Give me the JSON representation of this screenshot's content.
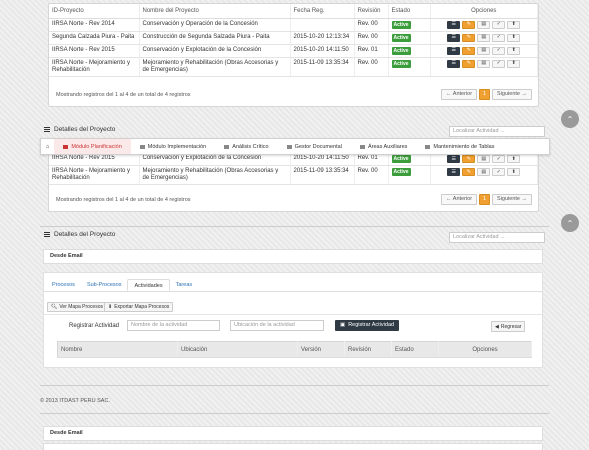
{
  "table": {
    "columns": [
      "ID-Proyecto",
      "Nombre del Proyecto",
      "Fecha Reg.",
      "Revisión",
      "Estado",
      "Opciones"
    ],
    "rows": [
      {
        "id": "IIRSA Norte - Rev 2014",
        "name": "Conservación y Operación de la Concesión",
        "date": "",
        "rev": "Rev. 00",
        "status": "Active"
      },
      {
        "id": "Segunda Calzada Piura - Paita",
        "name": "Construcción de Segunda Salzada Piura - Paita",
        "date": "2015-10-20 12:13:34",
        "rev": "Rev. 00",
        "status": "Active"
      },
      {
        "id": "IIRSA Norte - Rev 2015",
        "name": "Conservación y Explotación de la Concesión",
        "date": "2015-10-20 14:11:50",
        "rev": "Rev. 01",
        "status": "Active"
      },
      {
        "id": "IIRSA Norte - Mejoramiento y Rehabilitación",
        "name": "Mejoramiento y Rehabilitación (Obras Accesorias y de Emergencias)",
        "date": "2015-11-09 13:35:34",
        "rev": "Rev. 00",
        "status": "Active"
      }
    ],
    "info": "Mostrando registros del 1 al 4 de un total de 4 registros",
    "prev": "← Anterior",
    "page": "1",
    "next": "Siguiente →"
  },
  "table2": {
    "rows": [
      {
        "id": "IIRSA Norte - Rev 2015",
        "name": "Conservación y Explotación de la Concesión",
        "date": "2015-10-20 14:11:50",
        "rev": "Rev. 01",
        "status": "Active"
      },
      {
        "id": "IIRSA Norte - Mejoramiento y Rehabilitación",
        "name": "Mejoramiento y Rehabilitación (Obras Accesorias y de Emergencias)",
        "date": "2015-11-09 13:35:34",
        "rev": "Rev. 00",
        "status": "Active"
      }
    ],
    "info": "Mostrando registros del 1 al 4 de un total de 4 registros",
    "prev": "← Anterior",
    "page": "1",
    "next": "Siguiente →"
  },
  "detalles": {
    "title": "Detalles del Proyecto",
    "search_placeholder": "Localizar Actividad ..."
  },
  "module_tabs": [
    {
      "label": "Módulo Planificación"
    },
    {
      "label": "Módulo Implementación"
    },
    {
      "label": "Análisis Crítico"
    },
    {
      "label": "Gestor Documental"
    },
    {
      "label": "Áreas Auxiliares"
    },
    {
      "label": "Mantenimiento de Tablas"
    }
  ],
  "email_label": "Desde Email",
  "subtabs": [
    "Procesos",
    "Sub-Procesos",
    "Actividades",
    "Tareas"
  ],
  "buttons": {
    "ver_mapa": "Ver Mapa Procesos",
    "exportar_mapa": "Exportar Mapa Procesos",
    "registrar_label": "Registrar Actividad",
    "registrar_btn": "Registrar Actividad",
    "regresar": "Regresar"
  },
  "inputs": {
    "nombre_placeholder": "Nombre de la actividad",
    "ubicacion_placeholder": "Ubicación de la actividad"
  },
  "activity_table": {
    "columns": [
      "Nombre",
      "Ubicación",
      "Versión",
      "Revisión",
      "Estado",
      "Opciones"
    ]
  },
  "footer": "© 2013 ITDAST PERU SAC."
}
